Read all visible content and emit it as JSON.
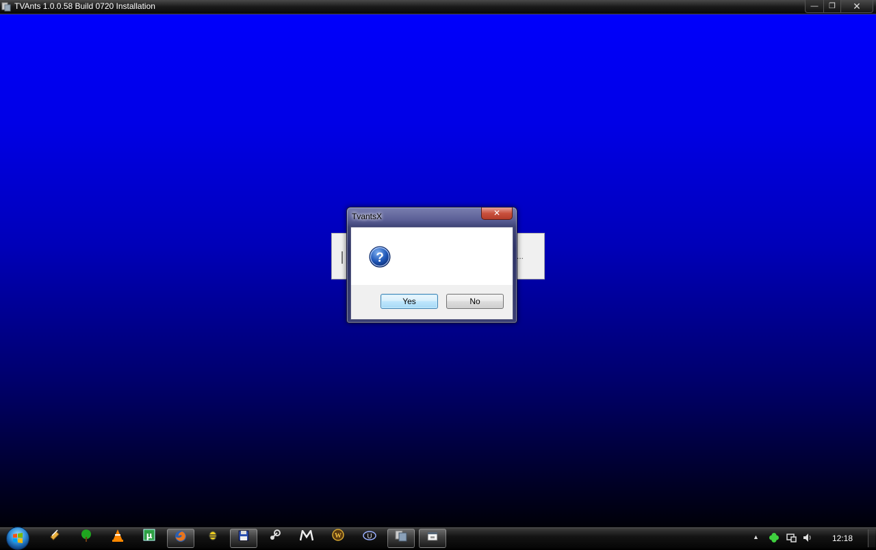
{
  "window": {
    "title": "TVAnts 1.0.0.58 Build 0720 Installation",
    "minimize_symbol": "—",
    "maximize_symbol": "❐",
    "close_symbol": "✕"
  },
  "background_dialog": {
    "trailing_text": "..."
  },
  "message_box": {
    "title": "TvantsX",
    "close_symbol": "✕",
    "icon": "question-icon",
    "yes_label": "Yes",
    "no_label": "No"
  },
  "taskbar": {
    "icons": [
      "file-manager-icon",
      "tree-icon",
      "vlc-icon",
      "utorrent-icon",
      "firefox-icon",
      "bee-icon",
      "installer-disk-icon",
      "steam-icon",
      "messenger-icon",
      "warcraft-icon",
      "unreal-icon",
      "tvants-installer-icon",
      "tvantsx-dialog-icon"
    ],
    "tray_arrow": "▲",
    "clock": "12:18"
  },
  "colors": {
    "desktop_top": "#0000ff",
    "desktop_bottom": "#000008",
    "close_red": "#c8503d",
    "default_button_blue": "#3c7fb1"
  }
}
